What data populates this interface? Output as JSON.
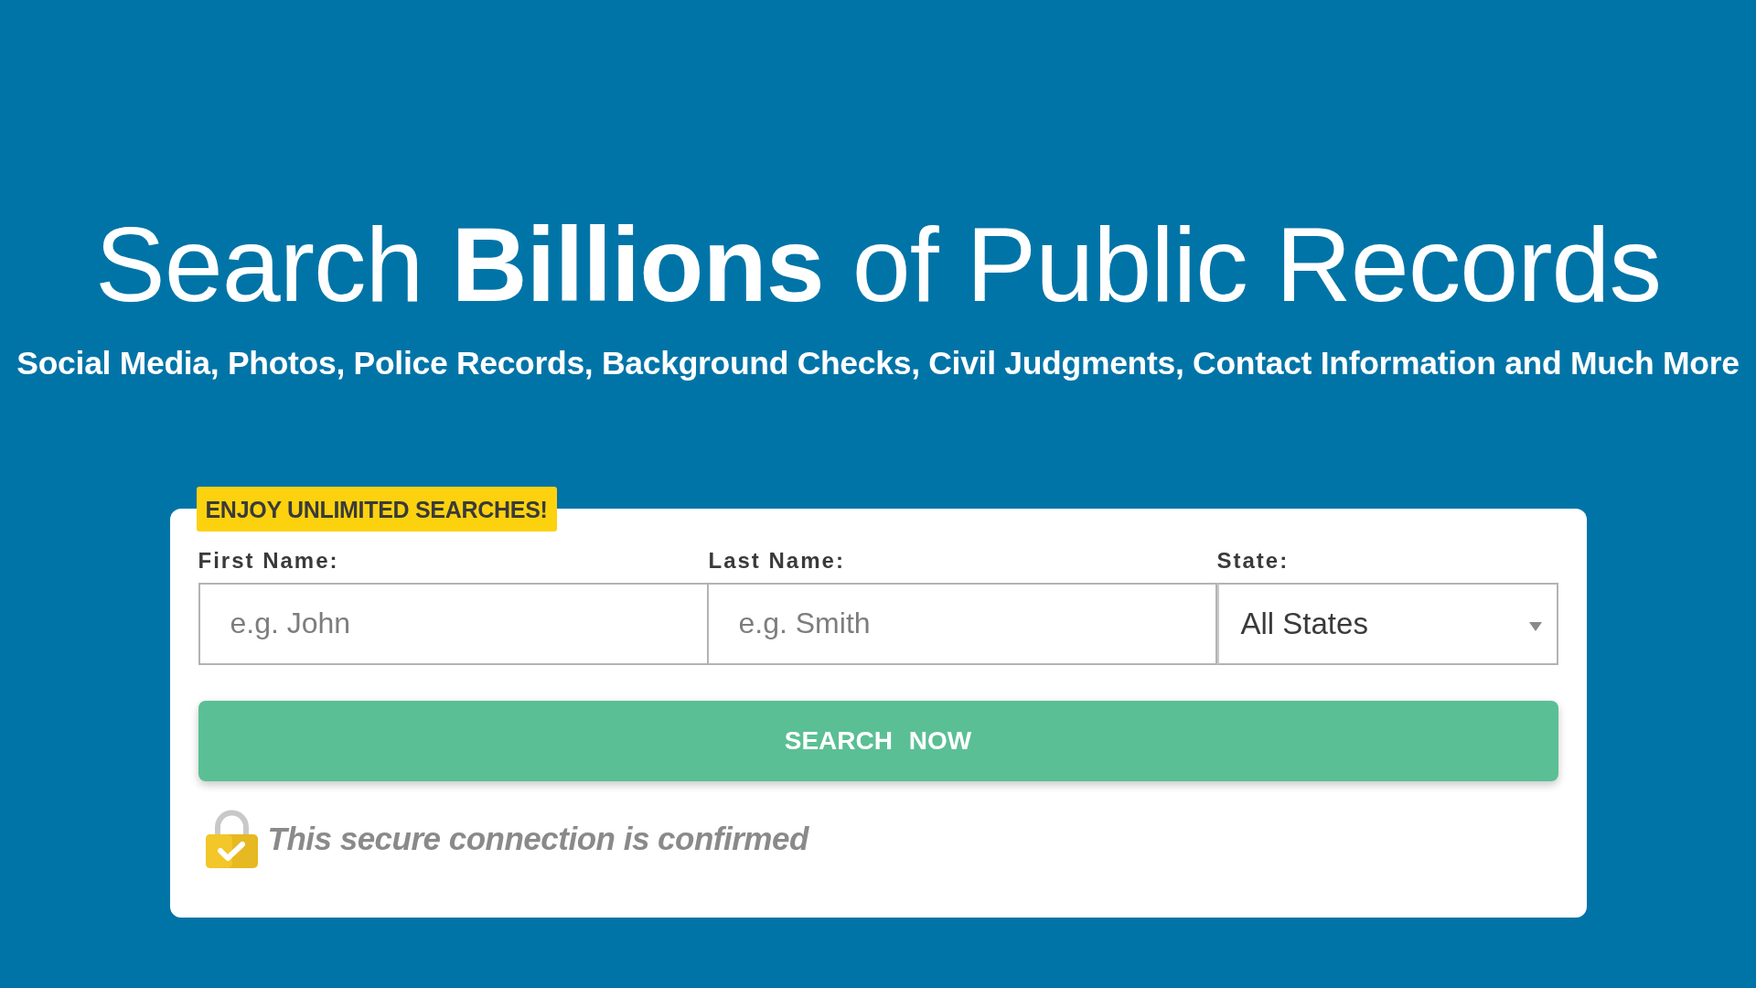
{
  "hero": {
    "title": "Search **Billions** of Public Records",
    "subtitle": "Social Media, Photos, Police Records, Background Checks, Civil Judgments, Contact Information and Much More"
  },
  "search_form": {
    "badge": "ENJOY UNLIMITED SEARCHES!",
    "fields": [
      {
        "kind": "text",
        "label": "First Name:",
        "placeholder": "e.g. John"
      },
      {
        "kind": "text",
        "label": "Last Name:",
        "placeholder": "e.g. Smith"
      },
      {
        "kind": "select",
        "label": "State:",
        "value": "All States"
      }
    ],
    "button": "SEARCH NOW",
    "security_note": "This secure connection is confirmed"
  }
}
